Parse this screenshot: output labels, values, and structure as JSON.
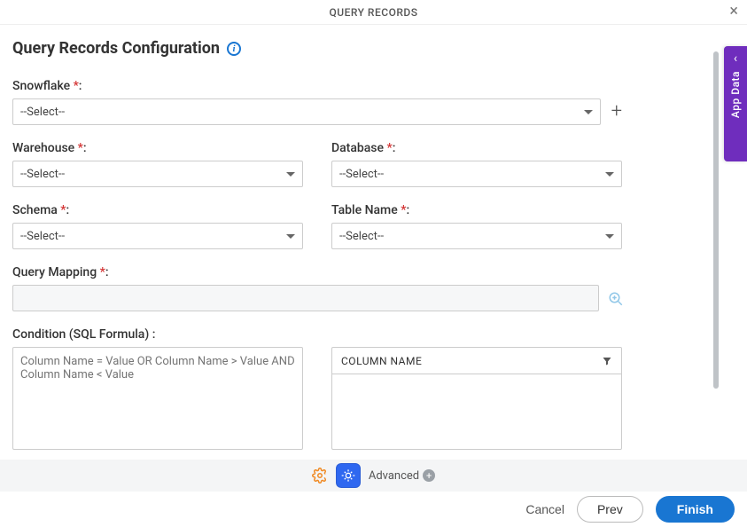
{
  "topbar": {
    "title": "QUERY RECORDS"
  },
  "page": {
    "title": "Query Records Configuration"
  },
  "sidebar": {
    "tab_label": "App Data"
  },
  "fields": {
    "snowflake": {
      "label": "Snowflake",
      "value": "--Select--"
    },
    "warehouse": {
      "label": "Warehouse",
      "value": "--Select--"
    },
    "database": {
      "label": "Database",
      "value": "--Select--"
    },
    "schema": {
      "label": "Schema",
      "value": "--Select--"
    },
    "table_name": {
      "label": "Table Name",
      "value": "--Select--"
    },
    "query_mapping": {
      "label": "Query Mapping",
      "value": ""
    },
    "condition": {
      "label": "Condition (SQL Formula) :",
      "placeholder": "Column Name = Value OR Column Name > Value AND Column Name < Value"
    },
    "column_box": {
      "header": "COLUMN NAME"
    }
  },
  "toolbar": {
    "advanced_label": "Advanced"
  },
  "footer": {
    "cancel_label": "Cancel",
    "prev_label": "Prev",
    "finish_label": "Finish"
  },
  "glyphs": {
    "required": " *",
    "colon": ":"
  }
}
